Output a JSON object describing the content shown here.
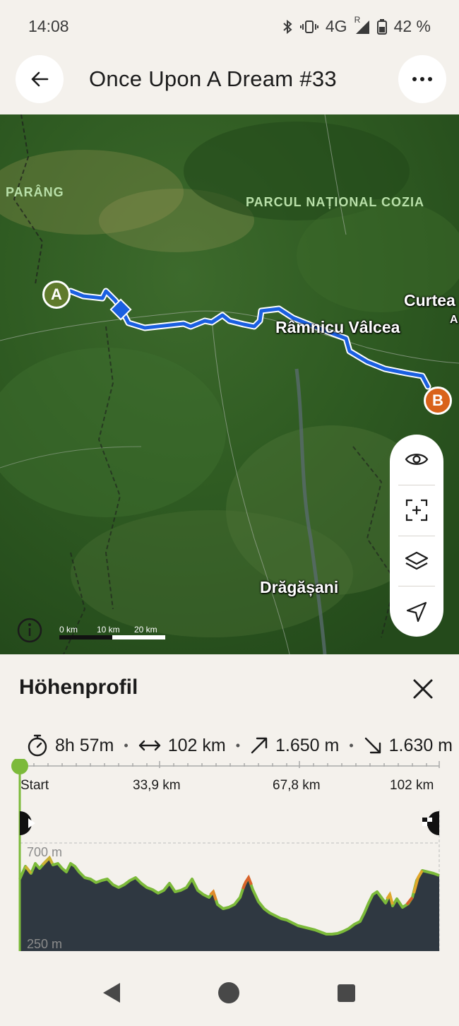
{
  "status": {
    "time": "14:08",
    "network": "4G",
    "roaming": "R",
    "battery": "42 %"
  },
  "header": {
    "title": "Once Upon A Dream #33",
    "back_icon": "arrow-left-icon",
    "more_icon": "more-horizontal-icon"
  },
  "map": {
    "labels": {
      "parang": "PARÂNG",
      "cozia": "PARCUL NAȚIONAL COZIA"
    },
    "cities": {
      "ramnicu": "Râmnicu Vâlcea",
      "curtea": "Curtea",
      "curtea_sub": "A",
      "dragasani": "Drăgășani"
    },
    "markers": {
      "start": "A",
      "end": "B"
    },
    "scale": {
      "s0": "0 km",
      "s1": "10 km",
      "s2": "20 km"
    },
    "controls": [
      "eye-icon",
      "focus-icon",
      "layers-icon",
      "navigate-icon"
    ],
    "route_color": "#1a5fe0"
  },
  "panel": {
    "title": "Höhenprofil",
    "stats": {
      "duration": "8h 57m",
      "distance": "102 km",
      "ascent": "1.650 m",
      "descent": "1.630 m"
    },
    "km_ticks": {
      "start": "Start",
      "t1": "33,9 km",
      "t2": "67,8 km",
      "t3": "102 km"
    },
    "elevation": {
      "max_label": "700 m",
      "min_label": "250 m"
    }
  }
}
